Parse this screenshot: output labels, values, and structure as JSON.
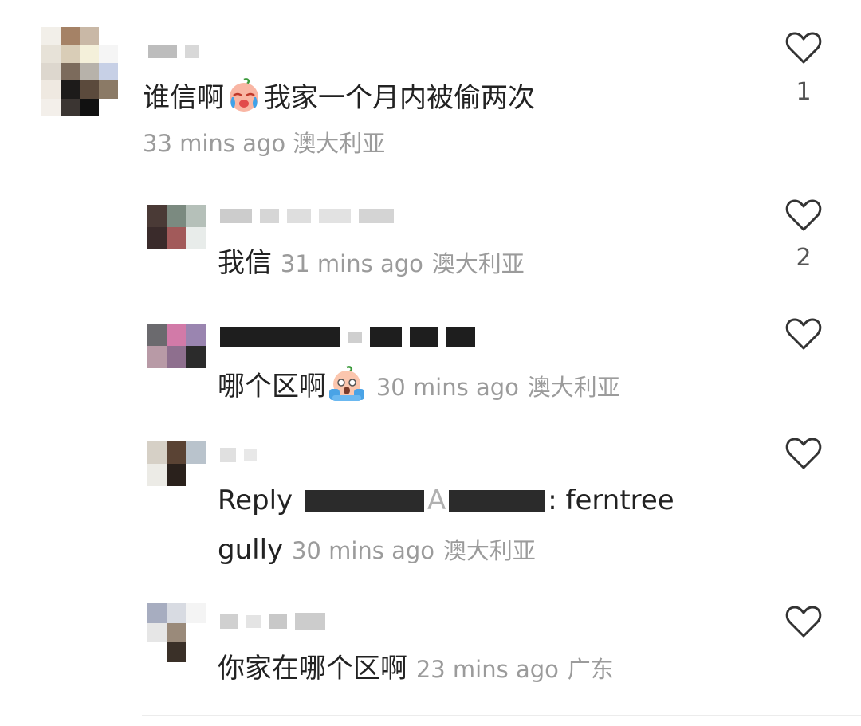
{
  "comments": [
    {
      "text": "谁信啊",
      "text_after_emoji": "我家一个月内被偷两次",
      "emoji": "crying-face",
      "time": "33 mins ago",
      "location": "澳大利亚",
      "likes": "1"
    },
    {
      "text": "我信",
      "time": "31 mins ago",
      "location": "澳大利亚",
      "likes": "2"
    },
    {
      "text": "哪个区啊",
      "emoji": "screaming-face",
      "time": "30 mins ago",
      "location": "澳大利亚",
      "likes": ""
    },
    {
      "reply_label": "Reply",
      "reply_tail": ": ferntree",
      "text_second_line": "gully",
      "time": "30 mins ago",
      "location": "澳大利亚",
      "likes": ""
    },
    {
      "text": "你家在哪个区啊",
      "time": "23 mins ago",
      "location": "广东",
      "likes": ""
    }
  ],
  "icons": {
    "heart": "heart-outline-icon"
  },
  "colors": {
    "text": "#222222",
    "meta": "#9b9b9b",
    "heart": "#333333"
  }
}
